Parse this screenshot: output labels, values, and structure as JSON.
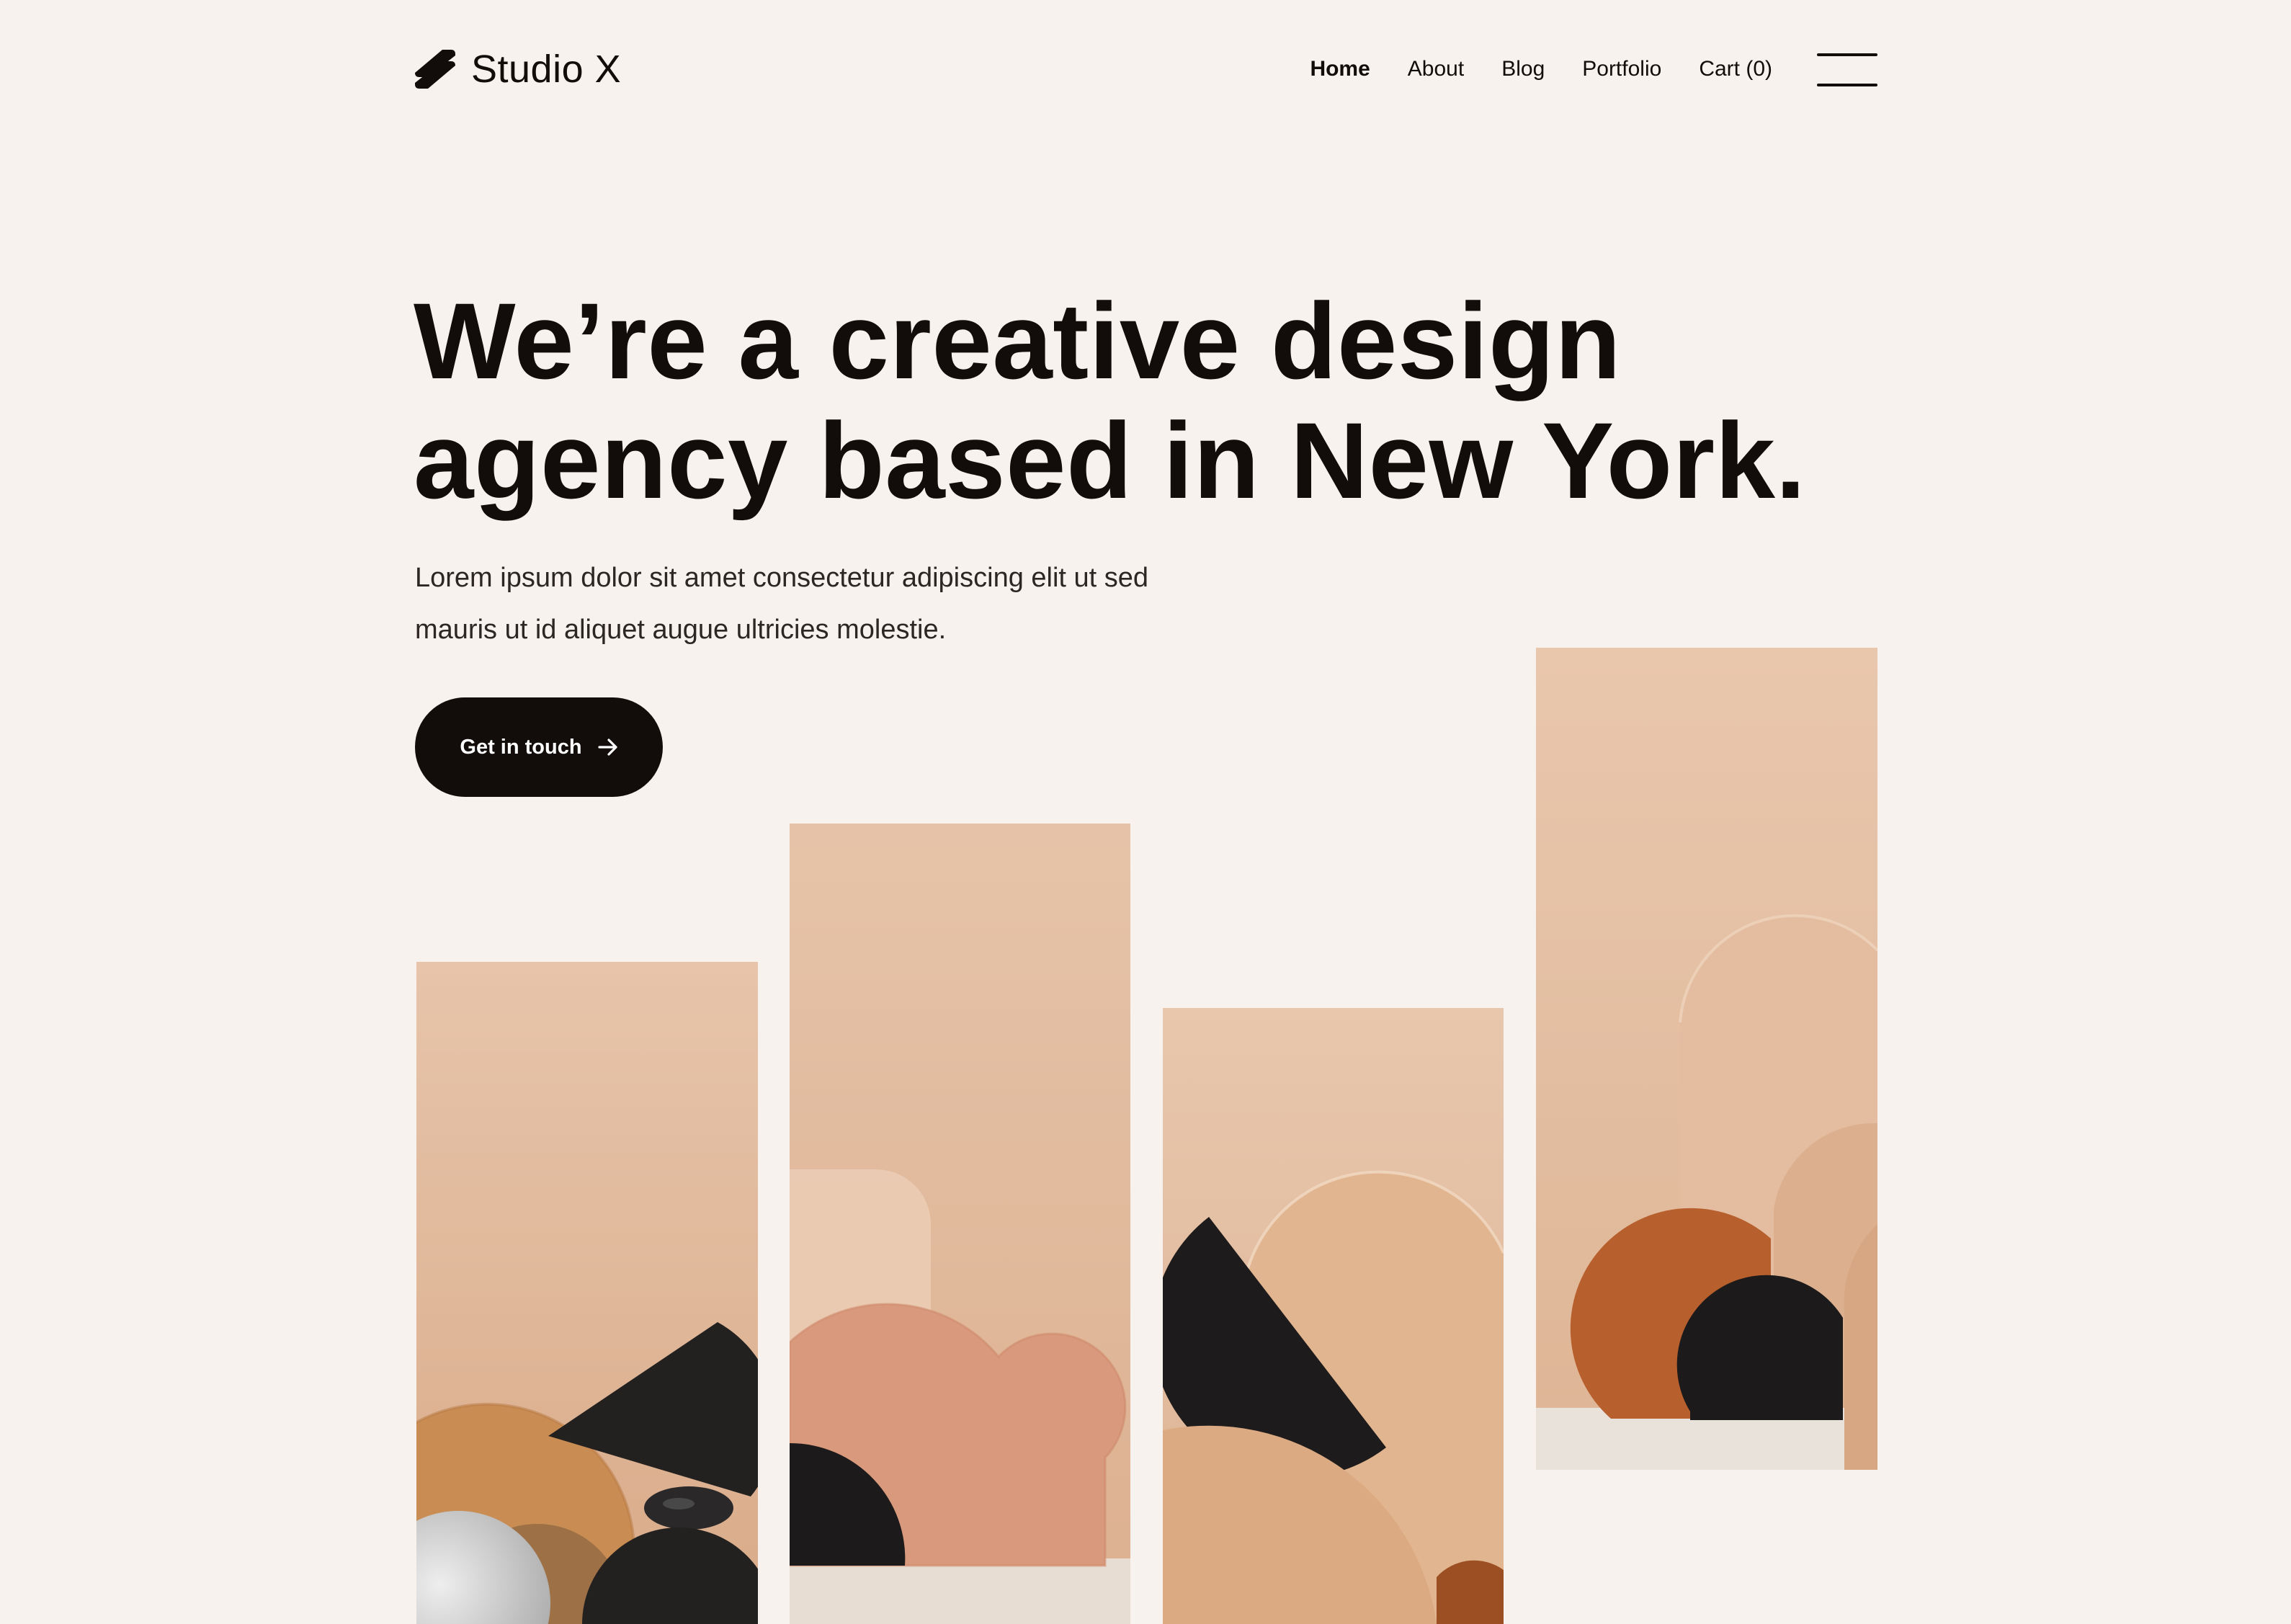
{
  "header": {
    "brand": "Studio X",
    "nav": [
      {
        "label": "Home",
        "active": true
      },
      {
        "label": "About",
        "active": false
      },
      {
        "label": "Blog",
        "active": false
      },
      {
        "label": "Portfolio",
        "active": false
      },
      {
        "label": "Cart (0)",
        "active": false
      }
    ],
    "menu_icon": "hamburger-icon"
  },
  "hero": {
    "title_lines": [
      "We’re a creative design",
      "agency based in New York."
    ],
    "text_lines": [
      "Lorem ipsum dolor sit amet consectetur adipiscing elit ut sed",
      "mauris ut id aliquet augue ultricies molestie."
    ],
    "cta_label": "Get in touch",
    "cta_icon": "arrow-right-icon"
  },
  "gallery": {
    "images": [
      "geometric-still-life-1",
      "geometric-still-life-2",
      "geometric-still-life-3",
      "geometric-still-life-4"
    ]
  },
  "colors": {
    "background": "#f7f2ee",
    "text": "#120d0b",
    "accent_dark": "#120d0b",
    "image_tone": "#e3b99c"
  }
}
